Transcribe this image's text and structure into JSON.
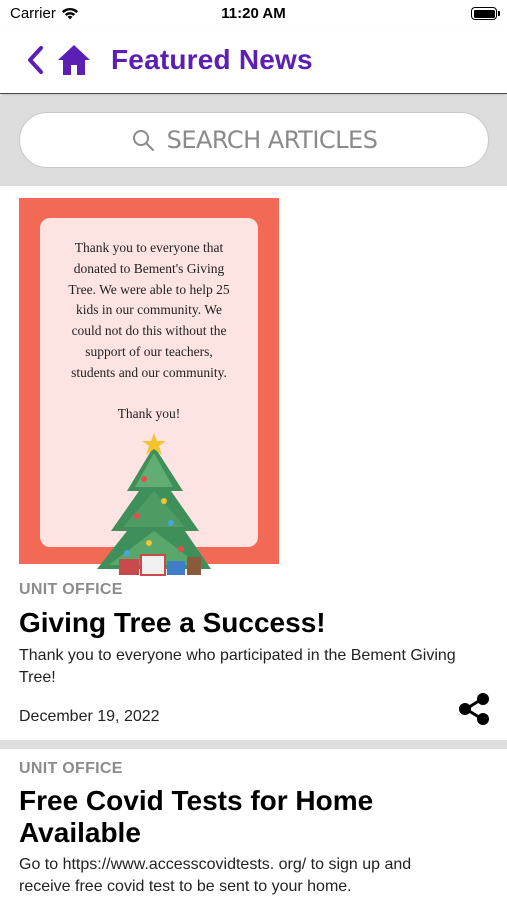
{
  "status_bar": {
    "carrier": "Carrier",
    "time": "11:20 AM",
    "battery_level": 1.0
  },
  "nav": {
    "back_icon": "chevron-left-icon",
    "home_icon": "home-icon",
    "title": "Featured News",
    "accent_color": "#5b1fb5"
  },
  "search": {
    "placeholder": "SEARCH ARTICLES",
    "icon": "search-icon"
  },
  "articles": [
    {
      "image_text": "Thank you to everyone that\ndonated to Bement's Giving\nTree.  We were able to help 25\nkids in our community.  We\ncould not do this without the\nsupport of our teachers,\nstudents and our community.\n\nThank you!",
      "category": "UNIT OFFICE",
      "title": "Giving Tree a Success!",
      "summary": "Thank you to everyone who participated in the Bement Giving Tree!",
      "date": "December 19, 2022",
      "share_icon": "share-icon"
    },
    {
      "category": "UNIT OFFICE",
      "title": "Free Covid Tests for Home Available",
      "summary": "Go to https://www.accesscovidtests. org/ to sign up and receive free covid test to be sent to your home."
    }
  ],
  "colors": {
    "image_background": "#f26a55",
    "image_card": "#fde4e2",
    "category_text": "#8c8c8c",
    "search_band": "#dcdcdc"
  }
}
